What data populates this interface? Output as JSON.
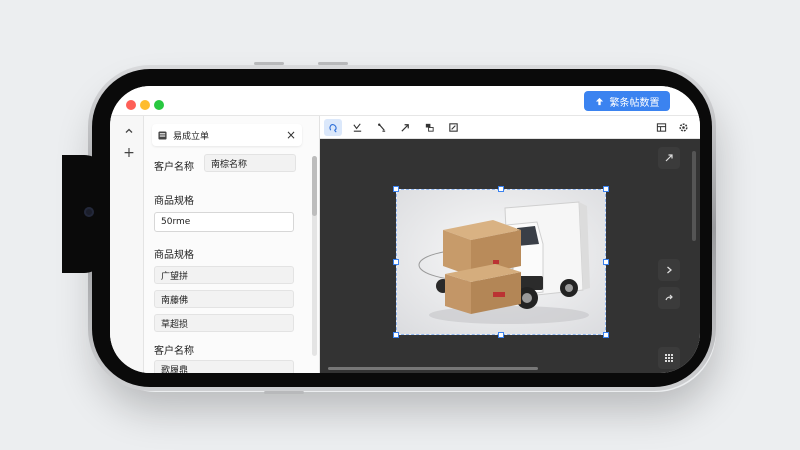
{
  "window": {
    "export_button": "繁条帖数置"
  },
  "panel": {
    "title": "易成立单",
    "close_glyph": "×",
    "rail_plus": "+",
    "field1": {
      "label": "客户名称",
      "value": "南棕名称"
    },
    "field2": {
      "label": "商品规格",
      "value": "50rme"
    },
    "field3": {
      "label": "商品规格",
      "items": [
        "广望拼",
        "南藤佛",
        "草超损"
      ]
    },
    "field4": {
      "label": "客户名称",
      "value": "歌履鼎"
    }
  },
  "colors": {
    "accent": "#3b83f0",
    "canvas_bg": "#333333",
    "panel_bg": "#fbfbfb"
  },
  "icons": {
    "toolbar": [
      "lasso-icon",
      "pen-icon",
      "brush-icon",
      "arrow-icon",
      "layers-icon",
      "crop-icon"
    ],
    "topbar_right": [
      "layout-icon",
      "settings-icon"
    ],
    "canvas_side": [
      "expand-icon",
      "next-icon",
      "share-icon",
      "grid-icon"
    ]
  },
  "canvas": {
    "image": "delivery-truck-with-cardboard-boxes"
  }
}
